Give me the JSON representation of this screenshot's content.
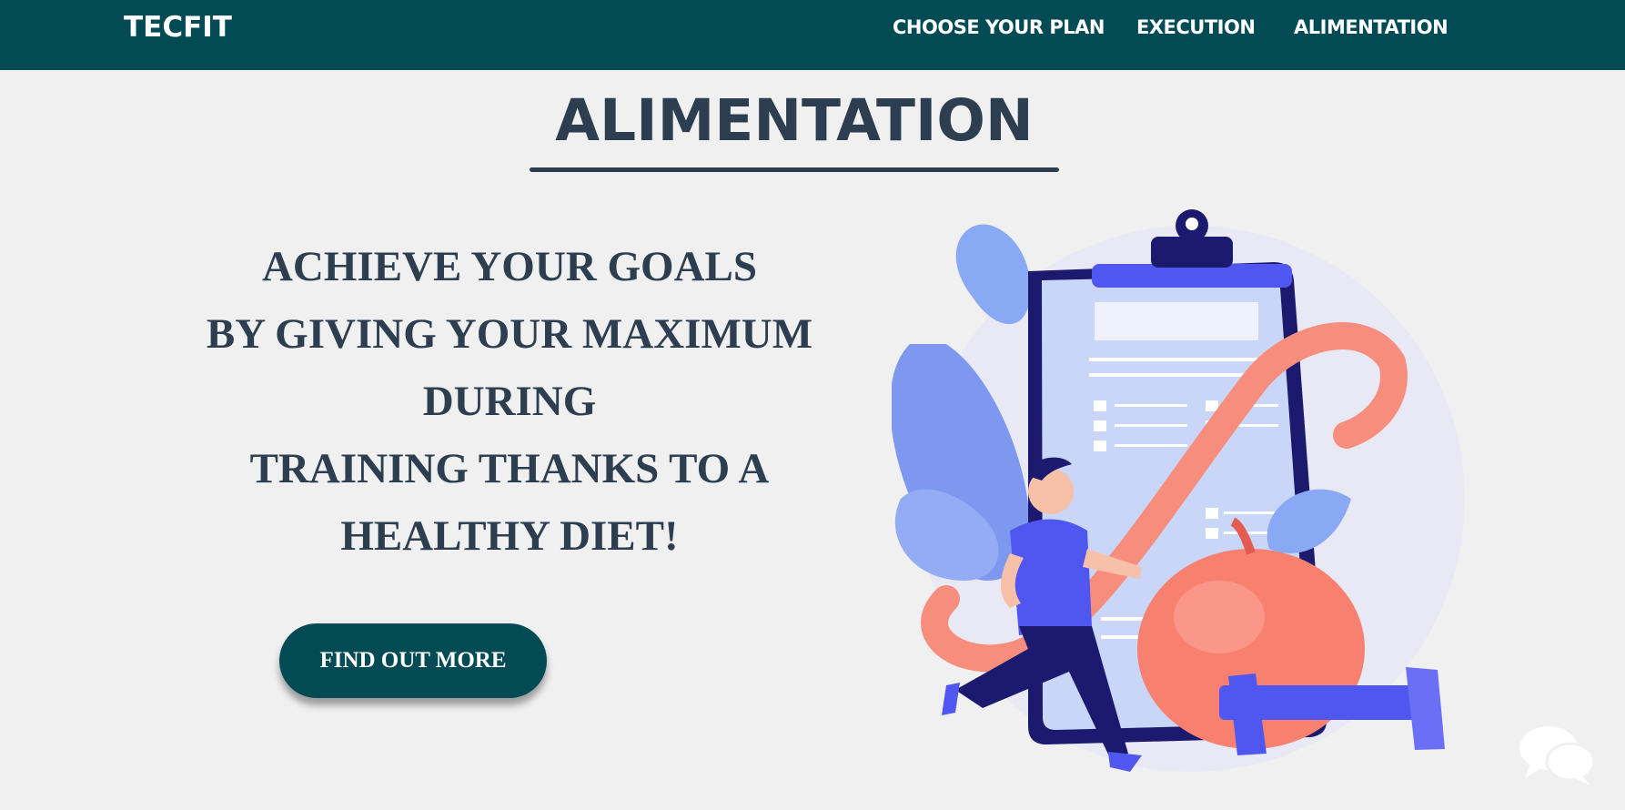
{
  "navbar": {
    "brand": "TECFIT",
    "links": [
      "CHOOSE YOUR PLAN",
      "EXECUTION",
      "ALIMENTATION"
    ]
  },
  "main": {
    "title": "ALIMENTATION",
    "hero_lines": [
      "ACHIEVE YOUR GOALS",
      "BY GIVING YOUR MAXIMUM",
      "DURING",
      "TRAINING THANKS TO A",
      "HEALTHY DIET!"
    ],
    "cta_label": "FIND OUT MORE"
  },
  "icons": {
    "illustration": "fitness-diet-illustration",
    "chat": "chat-bubbles-icon"
  },
  "colors": {
    "navbar_bg": "#024b55",
    "heading": "#2d3e50",
    "page_bg": "#f0f0f0",
    "accent_blue": "#5057f0",
    "accent_salmon": "#f78d7c"
  }
}
